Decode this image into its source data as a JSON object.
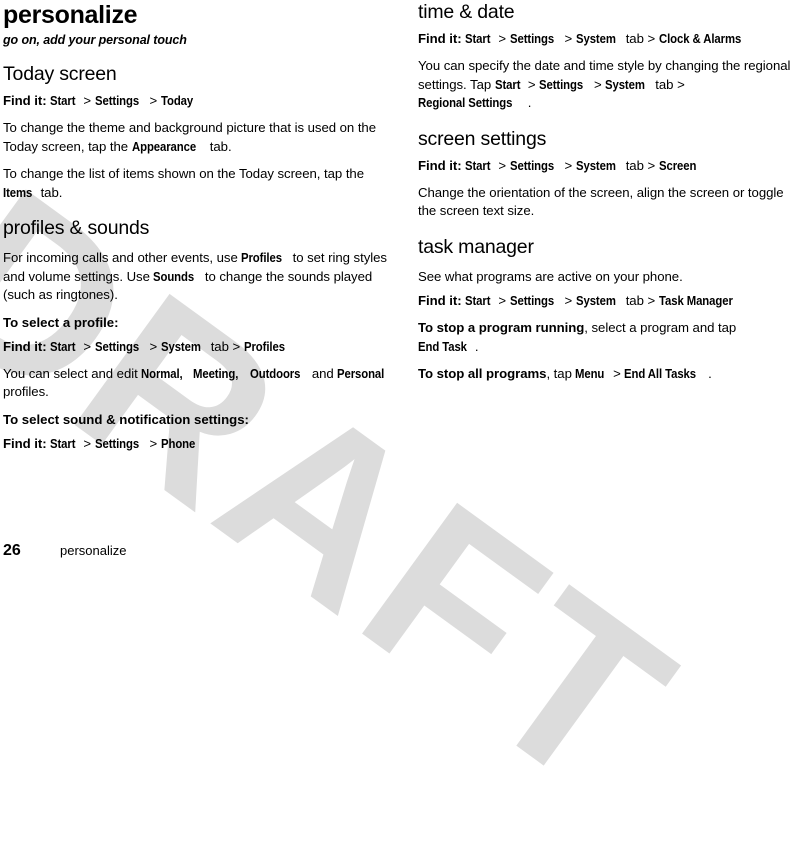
{
  "page": {
    "title": "personalize",
    "subtitle": "go on, add your personal touch",
    "number": "26",
    "footer_label": "personalize",
    "watermark": "DRAFT",
    "watermark_color": "#dcdcdc"
  },
  "left_column": {
    "sections": [
      {
        "heading": "Today screen",
        "findit": {
          "label": "Find it:",
          "path": [
            "Start",
            "Settings",
            "Today"
          ],
          "tab_word": ""
        },
        "paragraphs": [
          {
            "parts": [
              {
                "t": "To change the theme and background picture that is used on the Today screen, tap the ",
                "b": false
              },
              {
                "t": "Appearance",
                "b": true
              },
              {
                "t": " tab.",
                "b": false
              }
            ]
          },
          {
            "parts": [
              {
                "t": "To change the list of items shown on the Today screen, tap the ",
                "b": false
              },
              {
                "t": "Items",
                "b": true
              },
              {
                "t": " tab.",
                "b": false
              }
            ]
          }
        ]
      },
      {
        "heading": "profiles & sounds",
        "paragraphs": [
          {
            "parts": [
              {
                "t": "For incoming calls and other events, use ",
                "b": false
              },
              {
                "t": "Profiles",
                "b": true
              },
              {
                "t": " to set ring styles and volume settings. Use ",
                "b": false
              },
              {
                "t": "Sounds",
                "b": true
              },
              {
                "t": " to change the sounds played (such as ringtones).",
                "b": false
              }
            ]
          }
        ],
        "lead1": "To select a profile:",
        "findit2": {
          "label": "Find it:",
          "path": [
            "Start",
            "Settings",
            "System",
            "Profiles"
          ],
          "tab_word": "tab"
        },
        "paragraphs2": [
          {
            "parts": [
              {
                "t": "You can select and edit ",
                "b": false
              },
              {
                "t": "Normal,",
                "b": true
              },
              {
                "t": " ",
                "b": false
              },
              {
                "t": "Meeting,",
                "b": true
              },
              {
                "t": " ",
                "b": false
              },
              {
                "t": "Outdoors",
                "b": true
              },
              {
                "t": " and ",
                "b": false
              },
              {
                "t": "Personal",
                "b": true
              },
              {
                "t": " profiles.",
                "b": false
              }
            ]
          }
        ],
        "lead2": "To select sound & notification settings:",
        "findit3": {
          "label": "Find it:",
          "path": [
            "Start",
            "Settings",
            "Phone"
          ],
          "tab_word": ""
        }
      }
    ]
  },
  "right_column": {
    "sections": [
      {
        "heading": "time & date",
        "findit": {
          "label": "Find it:",
          "path": [
            "Start",
            "Settings",
            "System",
            "Clock & Alarms"
          ],
          "tab_word": "tab"
        },
        "paragraphs": [
          {
            "parts": [
              {
                "t": "You can specify the date and time style by changing the regional settings. Tap ",
                "b": false
              },
              {
                "t": "Start",
                "b": true
              },
              {
                "t": " > ",
                "b": false,
                "sep": true
              },
              {
                "t": "Settings",
                "b": true
              },
              {
                "t": " > ",
                "b": false,
                "sep": true
              },
              {
                "t": "System",
                "b": true
              },
              {
                "t": " tab > ",
                "b": false,
                "sep": true
              },
              {
                "t": "Regional Settings",
                "b": true
              },
              {
                "t": ".",
                "b": false
              }
            ]
          }
        ]
      },
      {
        "heading": "screen settings",
        "findit": {
          "label": "Find it:",
          "path": [
            "Start",
            "Settings",
            "System",
            "Screen"
          ],
          "tab_word": "tab"
        },
        "paragraphs": [
          {
            "parts": [
              {
                "t": "Change the orientation of the screen, align the screen or toggle the screen text size.",
                "b": false
              }
            ]
          }
        ]
      },
      {
        "heading": "task manager",
        "intro": "See what programs are active on your phone.",
        "findit": {
          "label": "Find it:",
          "path": [
            "Start",
            "Settings",
            "System",
            "Task Manager"
          ],
          "tab_word": "tab"
        },
        "instructions": [
          {
            "parts": [
              {
                "t": "To stop a program running",
                "b": true,
                "heavy": true
              },
              {
                "t": ", select a program and tap ",
                "b": false
              },
              {
                "t": "End Task",
                "b": true
              },
              {
                "t": ".",
                "b": false
              }
            ]
          },
          {
            "parts": [
              {
                "t": "To stop all programs",
                "b": true,
                "heavy": true
              },
              {
                "t": ", tap ",
                "b": false
              },
              {
                "t": "Menu",
                "b": true
              },
              {
                "t": " > ",
                "b": false,
                "sep": true
              },
              {
                "t": "End All Tasks",
                "b": true
              },
              {
                "t": ".",
                "b": false
              }
            ]
          }
        ]
      }
    ]
  }
}
